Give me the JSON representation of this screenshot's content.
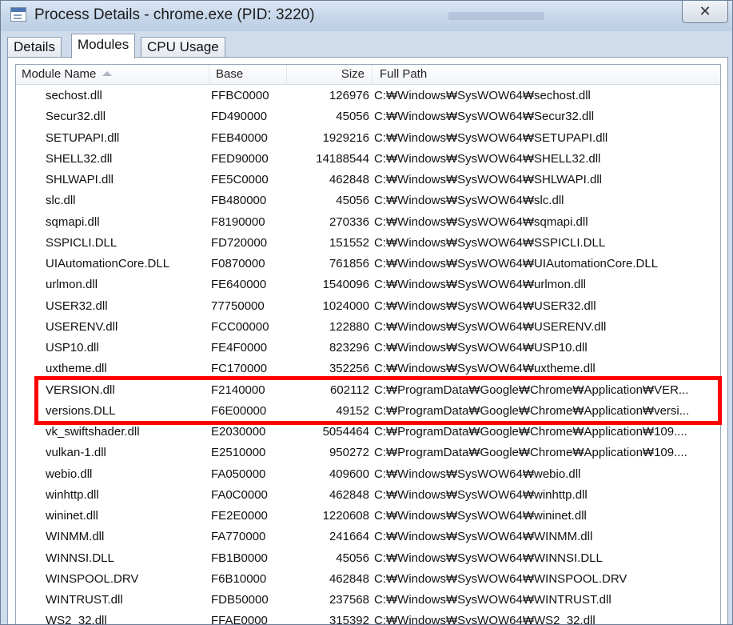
{
  "window": {
    "title": "Process Details - chrome.exe (PID: 3220)",
    "close_label": "✕"
  },
  "tabs": [
    {
      "label": "Details",
      "active": false
    },
    {
      "label": "Modules",
      "active": true
    },
    {
      "label": "CPU Usage",
      "active": false
    }
  ],
  "table": {
    "columns": {
      "name": "Module Name",
      "base": "Base",
      "size": "Size",
      "path": "Full Path"
    },
    "sort_icon": "sort-ascending-icon",
    "rows": [
      {
        "name": "sechost.dll",
        "base": "FFBC0000",
        "size": "126976",
        "path": "C:₩Windows₩SysWOW64₩sechost.dll"
      },
      {
        "name": "Secur32.dll",
        "base": "FD490000",
        "size": "45056",
        "path": "C:₩Windows₩SysWOW64₩Secur32.dll"
      },
      {
        "name": "SETUPAPI.dll",
        "base": "FEB40000",
        "size": "1929216",
        "path": "C:₩Windows₩SysWOW64₩SETUPAPI.dll"
      },
      {
        "name": "SHELL32.dll",
        "base": "FED90000",
        "size": "14188544",
        "path": "C:₩Windows₩SysWOW64₩SHELL32.dll"
      },
      {
        "name": "SHLWAPI.dll",
        "base": "FE5C0000",
        "size": "462848",
        "path": "C:₩Windows₩SysWOW64₩SHLWAPI.dll"
      },
      {
        "name": "slc.dll",
        "base": "FB480000",
        "size": "45056",
        "path": "C:₩Windows₩SysWOW64₩slc.dll"
      },
      {
        "name": "sqmapi.dll",
        "base": "F8190000",
        "size": "270336",
        "path": "C:₩Windows₩SysWOW64₩sqmapi.dll"
      },
      {
        "name": "SSPICLI.DLL",
        "base": "FD720000",
        "size": "151552",
        "path": "C:₩Windows₩SysWOW64₩SSPICLI.DLL"
      },
      {
        "name": "UIAutomationCore.DLL",
        "base": "F0870000",
        "size": "761856",
        "path": "C:₩Windows₩SysWOW64₩UIAutomationCore.DLL"
      },
      {
        "name": "urlmon.dll",
        "base": "FE640000",
        "size": "1540096",
        "path": "C:₩Windows₩SysWOW64₩urlmon.dll"
      },
      {
        "name": "USER32.dll",
        "base": "77750000",
        "size": "1024000",
        "path": "C:₩Windows₩SysWOW64₩USER32.dll"
      },
      {
        "name": "USERENV.dll",
        "base": "FCC00000",
        "size": "122880",
        "path": "C:₩Windows₩SysWOW64₩USERENV.dll"
      },
      {
        "name": "USP10.dll",
        "base": "FE4F0000",
        "size": "823296",
        "path": "C:₩Windows₩SysWOW64₩USP10.dll"
      },
      {
        "name": "uxtheme.dll",
        "base": "FC170000",
        "size": "352256",
        "path": "C:₩Windows₩SysWOW64₩uxtheme.dll"
      },
      {
        "name": "VERSION.dll",
        "base": "F2140000",
        "size": "602112",
        "path": "C:₩ProgramData₩Google₩Chrome₩Application₩VER..."
      },
      {
        "name": "versions.DLL",
        "base": "F6E00000",
        "size": "49152",
        "path": "C:₩ProgramData₩Google₩Chrome₩Application₩versi..."
      },
      {
        "name": "vk_swiftshader.dll",
        "base": "E2030000",
        "size": "5054464",
        "path": "C:₩ProgramData₩Google₩Chrome₩Application₩109...."
      },
      {
        "name": "vulkan-1.dll",
        "base": "E2510000",
        "size": "950272",
        "path": "C:₩ProgramData₩Google₩Chrome₩Application₩109...."
      },
      {
        "name": "webio.dll",
        "base": "FA050000",
        "size": "409600",
        "path": "C:₩Windows₩SysWOW64₩webio.dll"
      },
      {
        "name": "winhttp.dll",
        "base": "FA0C0000",
        "size": "462848",
        "path": "C:₩Windows₩SysWOW64₩winhttp.dll"
      },
      {
        "name": "wininet.dll",
        "base": "FE2E0000",
        "size": "1220608",
        "path": "C:₩Windows₩SysWOW64₩wininet.dll"
      },
      {
        "name": "WINMM.dll",
        "base": "FA770000",
        "size": "241664",
        "path": "C:₩Windows₩SysWOW64₩WINMM.dll"
      },
      {
        "name": "WINNSI.DLL",
        "base": "FB1B0000",
        "size": "45056",
        "path": "C:₩Windows₩SysWOW64₩WINNSI.DLL"
      },
      {
        "name": "WINSPOOL.DRV",
        "base": "F6B10000",
        "size": "462848",
        "path": "C:₩Windows₩SysWOW64₩WINSPOOL.DRV"
      },
      {
        "name": "WINTRUST.dll",
        "base": "FDB50000",
        "size": "237568",
        "path": "C:₩Windows₩SysWOW64₩WINTRUST.dll"
      },
      {
        "name": "WS2_32.dll",
        "base": "FFAE0000",
        "size": "315392",
        "path": "C:₩Windows₩SysWOW64₩WS2_32.dll"
      }
    ]
  },
  "colors": {
    "highlight": "#ff0000",
    "titlebar": "#c6d6ea"
  }
}
